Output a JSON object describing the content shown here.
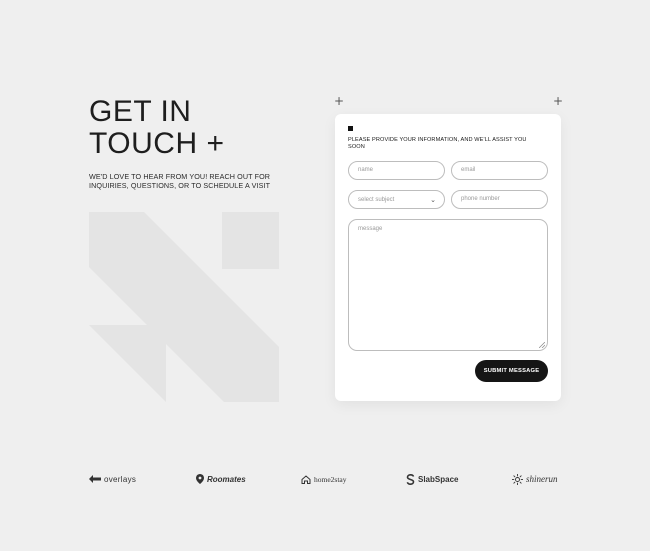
{
  "hero": {
    "title_line1": "GET IN",
    "title_line2": "TOUCH +",
    "subtitle": "WE'D LOVE TO HEAR FROM YOU! REACH OUT FOR INQUIRIES, QUESTIONS, OR TO SCHEDULE A VISIT"
  },
  "form": {
    "intro": "PLEASE PROVIDE YOUR INFORMATION, AND WE'LL ASSIST YOU SOON",
    "name_placeholder": "name",
    "email_placeholder": "email",
    "subject_selected": "select subject",
    "phone_placeholder": "phone number",
    "message_placeholder": "message",
    "submit_label": "SUBMIT MESSAGE"
  },
  "partners": [
    {
      "name": "overlays",
      "icon": "diamond-arrow-icon"
    },
    {
      "name": "Roomates",
      "icon": "location-pin-icon"
    },
    {
      "name": "home2stay",
      "icon": "house-icon"
    },
    {
      "name": "SlabSpace",
      "icon": "s-shape-icon"
    },
    {
      "name": "shinerun",
      "icon": "sun-icon"
    }
  ],
  "colors": {
    "background": "#efefef",
    "card": "#ffffff",
    "button": "#151515",
    "mark": "#e3e3e3"
  }
}
